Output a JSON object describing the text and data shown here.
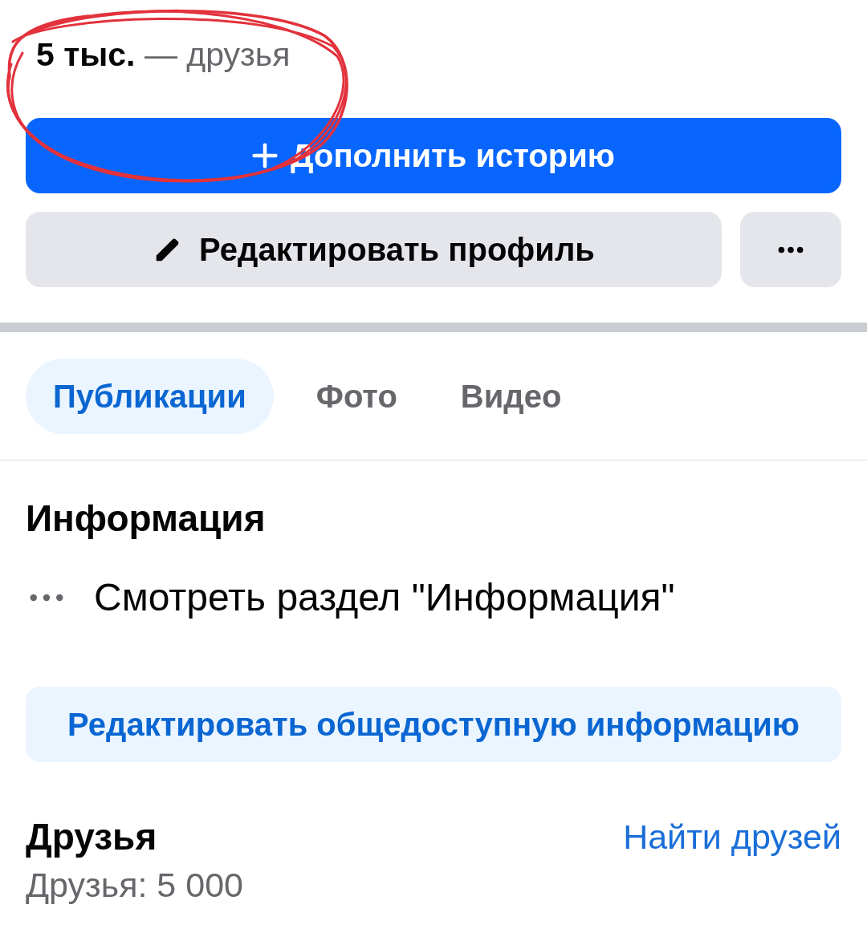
{
  "friends_summary": {
    "count": "5 тыс.",
    "label": "— друзья",
    "circled": true
  },
  "story_button": {
    "label": "Дополнить историю"
  },
  "edit_profile_button": {
    "label": "Редактировать профиль"
  },
  "tabs": [
    {
      "label": "Публикации",
      "selected": true
    },
    {
      "label": "Фото",
      "selected": false
    },
    {
      "label": "Видео",
      "selected": false
    }
  ],
  "intro": {
    "title": "Информация",
    "items": [
      {
        "label": "Смотреть раздел \"Информация\""
      }
    ],
    "edit_button": {
      "label": "Редактировать общедоступную информацию"
    }
  },
  "friends": {
    "title": "Друзья",
    "find_link": "Найти друзей",
    "count": "Друзья: 5 000"
  }
}
